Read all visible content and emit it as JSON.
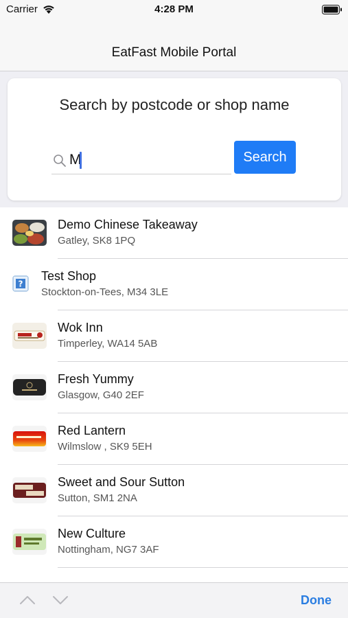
{
  "status_bar": {
    "carrier": "Carrier",
    "time": "4:28 PM"
  },
  "nav": {
    "title": "EatFast Mobile Portal"
  },
  "search": {
    "heading": "Search by postcode or shop name",
    "value": "M",
    "button_label": "Search"
  },
  "shops": [
    {
      "name": "Demo Chinese Takeaway",
      "address": "Gatley, SK8 1PQ",
      "thumb": "food-photo"
    },
    {
      "name": "Test Shop",
      "address": "Stockton-on-Tees, M34 3LE",
      "thumb": "placeholder-question"
    },
    {
      "name": "Wok Inn",
      "address": "Timperley, WA14 5AB",
      "thumb": "wok-inn-logo"
    },
    {
      "name": "Fresh Yummy",
      "address": "Glasgow, G40 2EF",
      "thumb": "fresh-yummy-logo"
    },
    {
      "name": "Red Lantern",
      "address": "Wilmslow , SK9 5EH",
      "thumb": "red-lantern-logo"
    },
    {
      "name": "Sweet and Sour Sutton",
      "address": "Sutton, SM1 2NA",
      "thumb": "sweet-sour-logo"
    },
    {
      "name": "New Culture",
      "address": "Nottingham, NG7 3AF",
      "thumb": "new-culture-logo"
    }
  ],
  "toolbar": {
    "done_label": "Done"
  },
  "colors": {
    "accent": "#1f7cf6",
    "done": "#2a7de1",
    "caret": "#3f6fe0"
  }
}
